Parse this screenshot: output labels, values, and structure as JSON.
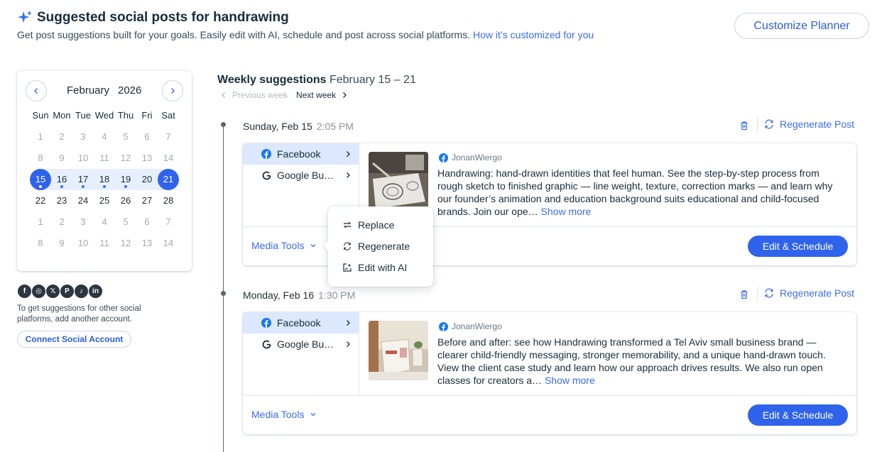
{
  "header": {
    "title": "Suggested social posts for handrawing",
    "subtitle": "Get post suggestions built for your goals. Easily edit with AI, schedule and post across social platforms.",
    "subtitle_link": "How it’s customized for you",
    "customize_button": "Customize Planner"
  },
  "calendar": {
    "month": "February",
    "year": "2026",
    "weekdays": [
      "Sun",
      "Mon",
      "Tue",
      "Wed",
      "Thu",
      "Fri",
      "Sat"
    ],
    "rows": [
      [
        "1",
        "2",
        "3",
        "4",
        "5",
        "6",
        "7"
      ],
      [
        "8",
        "9",
        "10",
        "11",
        "12",
        "13",
        "14"
      ],
      [
        "15",
        "16",
        "17",
        "18",
        "19",
        "20",
        "21"
      ],
      [
        "22",
        "23",
        "24",
        "25",
        "26",
        "27",
        "28"
      ],
      [
        "1",
        "2",
        "3",
        "4",
        "5",
        "6",
        "7"
      ],
      [
        "8",
        "9",
        "10",
        "11",
        "12",
        "13",
        "14"
      ]
    ],
    "current_month_rows": [
      2,
      3
    ],
    "selected_week_row": 2,
    "selected_days": [
      "15",
      "21"
    ],
    "days_with_posts": [
      "15",
      "16",
      "17",
      "18",
      "19"
    ],
    "accent_color": "#2f63ec"
  },
  "social": {
    "icons": [
      "facebook-icon",
      "instagram-icon",
      "x-icon",
      "pinterest-icon",
      "tiktok-icon",
      "linkedin-icon"
    ],
    "icon_glyphs": [
      "f",
      "◎",
      "𝕏",
      "P",
      "♪",
      "in"
    ],
    "text": "To get suggestions for other social platforms, add another account.",
    "connect_button": "Connect Social Account"
  },
  "weekly": {
    "title": "Weekly suggestions",
    "range": "February 15 – 21",
    "prev_week": "Previous week",
    "next_week": "Next week"
  },
  "posts": [
    {
      "day": "Sunday, Feb 15",
      "time": "2:05 PM",
      "regenerate": "Regenerate Post",
      "platforms": [
        "Facebook",
        "Google Bu…"
      ],
      "author": "JonanWiergo",
      "text": "Handrawing: hand-drawn identities that feel human. See the step-by-step process from rough sketch to finished graphic — line weight, texture, correction marks — and learn why our founder’s animation and education background suits educational and child-focused brands. Join our ope…",
      "show_more": "Show more",
      "media_tools": "Media Tools",
      "edit_button": "Edit & Schedule"
    },
    {
      "day": "Monday, Feb 16",
      "time": "1:30 PM",
      "regenerate": "Regenerate Post",
      "platforms": [
        "Facebook",
        "Google Bu…"
      ],
      "author": "JonanWiergo",
      "text": "Before and after: see how Handrawing transformed a Tel Aviv small business brand — clearer child-friendly messaging, stronger memorability, and a unique hand-drawn touch. View the client case study and learn how our approach drives results. We also run open classes for creators a…",
      "show_more": "Show more",
      "media_tools": "Media Tools",
      "edit_button": "Edit & Schedule"
    }
  ],
  "media_menu": {
    "items": [
      "Replace",
      "Regenerate",
      "Edit with AI"
    ]
  }
}
